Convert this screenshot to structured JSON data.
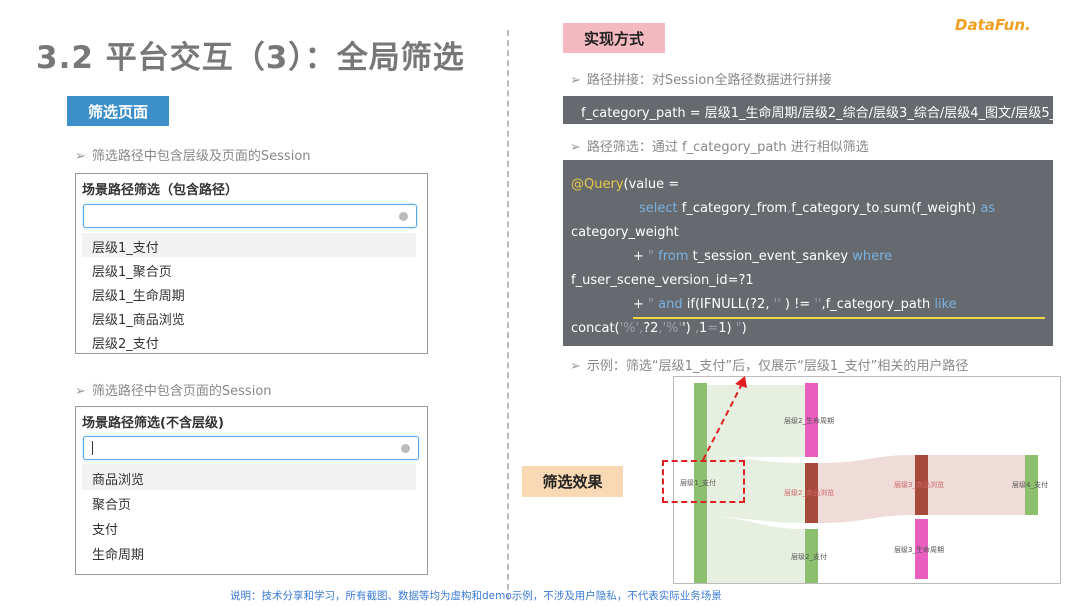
{
  "slide": {
    "title": "3.2 平台交互（3）：全局筛选",
    "logo": "DataFun.",
    "footnote": "说明：技术分享和学习，所有截图、数据等均为虚构和demo示例，不涉及用户隐私，不代表实际业务场景"
  },
  "left": {
    "badge": "筛选页面",
    "bullet1": "筛选路径中包含层级及页面的Session",
    "panel1": {
      "title": "场景路径筛选（包含路径）",
      "options": [
        "层级1_支付",
        "层级1_聚合页",
        "层级1_生命周期",
        "层级1_商品浏览",
        "层级2_支付"
      ]
    },
    "bullet2": "筛选路径中包含页面的Session",
    "panel2": {
      "title": "场景路径筛选(不含层级)",
      "options": [
        "商品浏览",
        "聚合页",
        "支付",
        "生命周期"
      ]
    }
  },
  "right": {
    "badge": "实现方式",
    "bullet1": "路径拼接：对Session全路径数据进行拼接",
    "path_code": "f_category_path = 层级1_生命周期/层级2_综合/层级3_综合/层级4_图文/层级5_",
    "bullet2": "路径筛选：通过 f_category_path 进行相似筛选",
    "code": {
      "l1a": "@Query",
      "l1b": "(value =",
      "l2a": "select",
      "l2b": "f_category_from",
      "l2c": "f_category_to",
      "l2d": "sum(f_weight)",
      "l2e": "as",
      "l3": "category_weight",
      "l4a": "+",
      "l4b": "from",
      "l4c": "t_session_event_sankey",
      "l4d": "where",
      "l5": "f_user_scene_version_id=?1",
      "l6a": "+",
      "l6b": "and",
      "l6c": "if(IFNULL(?2,",
      "l6d": ") !=",
      "l6e": ",f_category_path",
      "l6f": "like",
      "l7a": "concat(",
      "l7b": "?2",
      "l7c": "')",
      "l7d": "1",
      "l7e": "1)",
      "l7f": ")"
    },
    "bullet3": "示例：筛选“层级1_支付”后，仅展示“层级1_支付”相关的用户路径",
    "effect_badge": "筛选效果",
    "sankey": {
      "n1": "层级1_支付",
      "n2": "层级2_生命周期",
      "n3": "层级2_商品浏览",
      "n4": "层级2_支付",
      "n5": "层级3_商品浏览",
      "n6": "层级3_生命周期",
      "n7": "层级4_支付"
    },
    "colors": {
      "green": "#8cbf6e",
      "pink": "#e85fc0",
      "brown": "#a64a3c",
      "flow_green": "#e6efe0",
      "flow_brown": "#efdcd8"
    }
  }
}
